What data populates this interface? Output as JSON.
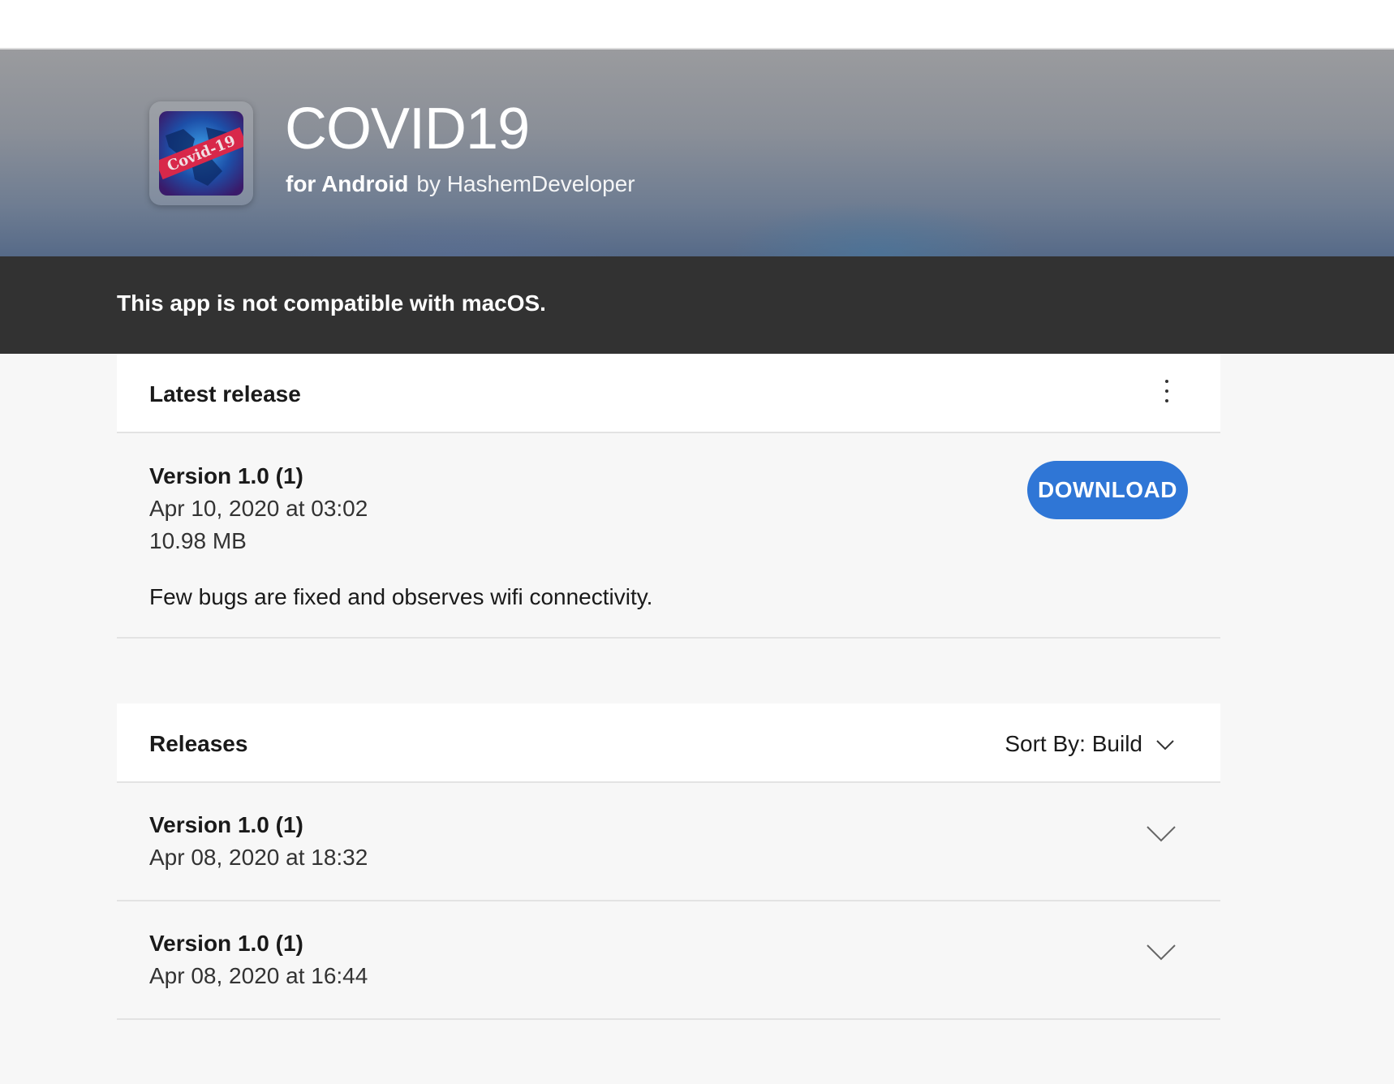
{
  "app": {
    "title": "COVID19",
    "platform": "for Android",
    "author": "by HashemDeveloper",
    "icon_label": "Covid-19"
  },
  "notice": {
    "text": "This app is not compatible with macOS."
  },
  "latest_release": {
    "heading": "Latest release",
    "version": "Version 1.0 (1)",
    "date": "Apr 10, 2020 at 03:02",
    "size": "10.98 MB",
    "notes": "Few bugs are fixed and observes wifi connectivity.",
    "download_label": "DOWNLOAD",
    "menu_icon": "more-vertical-icon"
  },
  "releases": {
    "heading": "Releases",
    "sort_label": "Sort By: Build",
    "sort_icon": "chevron-down-icon",
    "items": [
      {
        "version": "Version 1.0 (1)",
        "date": "Apr 08, 2020 at 18:32"
      },
      {
        "version": "Version 1.0 (1)",
        "date": "Apr 08, 2020 at 16:44"
      }
    ]
  },
  "colors": {
    "accent": "#2f76d6",
    "notice_bg": "#323232",
    "page_bg": "#f7f7f7"
  }
}
